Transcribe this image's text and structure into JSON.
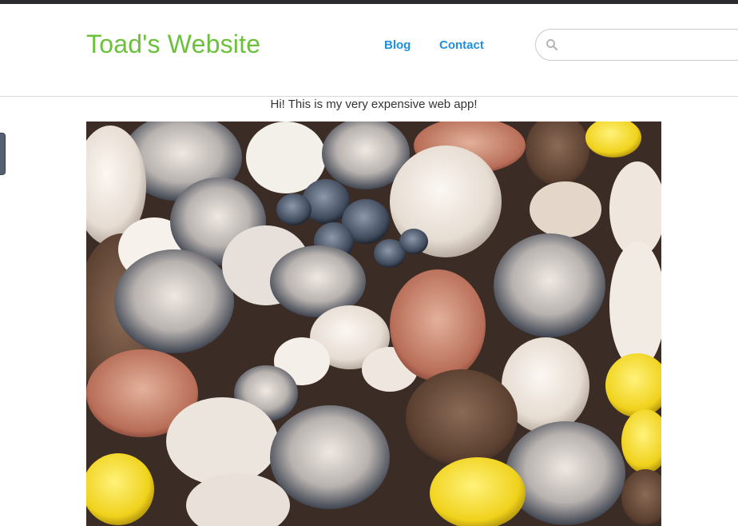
{
  "site": {
    "title": "Toad's Website"
  },
  "nav": {
    "items": [
      {
        "label": "Blog"
      },
      {
        "label": "Contact"
      }
    ]
  },
  "search": {
    "placeholder": "",
    "value": "",
    "icon": "search-icon"
  },
  "main": {
    "greeting": "Hi! This is my very expensive web app!"
  },
  "colors": {
    "brand": "#6cc13a",
    "link": "#1e90e0",
    "topbar": "#2b2b30"
  }
}
